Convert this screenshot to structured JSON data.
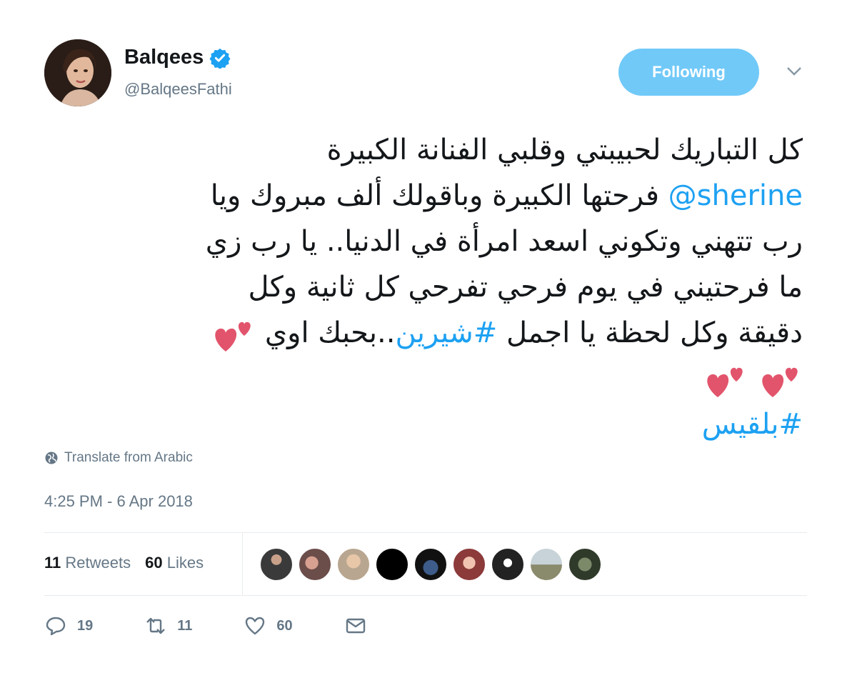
{
  "author": {
    "display_name": "Balqees",
    "handle": "@BalqeesFathi",
    "verified": true
  },
  "follow_button": {
    "label": "Following"
  },
  "tweet": {
    "lines": [
      "كل التباريك لحبيبتي وقلبي الفنانة الكبيرة",
      {
        "mention": "@sherine",
        "text": " فرحتها الكبيرة وباقولك ألف مبروك ويا"
      },
      "رب تتهني وتكوني اسعد امرأة في الدنيا.. يا رب زي",
      "ما فرحتيني في يوم فرحي تفرحي كل ثانية وكل",
      {
        "text_before": "دقيقة وكل لحظة يا اجمل ",
        "hashtag": "#شيرين",
        "text_after": "..بحبك اوي"
      },
      {
        "emoji": "two-hearts x2"
      },
      {
        "hashtag": "#بلقيس"
      }
    ]
  },
  "translate_link": "Translate from Arabic",
  "timestamp": "4:25 PM - 6 Apr 2018",
  "stats": {
    "retweets_count": "11",
    "retweets_label": "Retweets",
    "likes_count": "60",
    "likes_label": "Likes"
  },
  "actions": {
    "replies": "19",
    "retweets": "11",
    "likes": "60"
  },
  "colors": {
    "link": "#1da1f2",
    "button": "#71c9f8",
    "muted": "#657786",
    "heart": "#e2546c"
  },
  "icons": [
    "verified-badge-icon",
    "chevron-down-icon",
    "globe-icon",
    "reply-icon",
    "retweet-icon",
    "like-icon",
    "message-icon"
  ]
}
